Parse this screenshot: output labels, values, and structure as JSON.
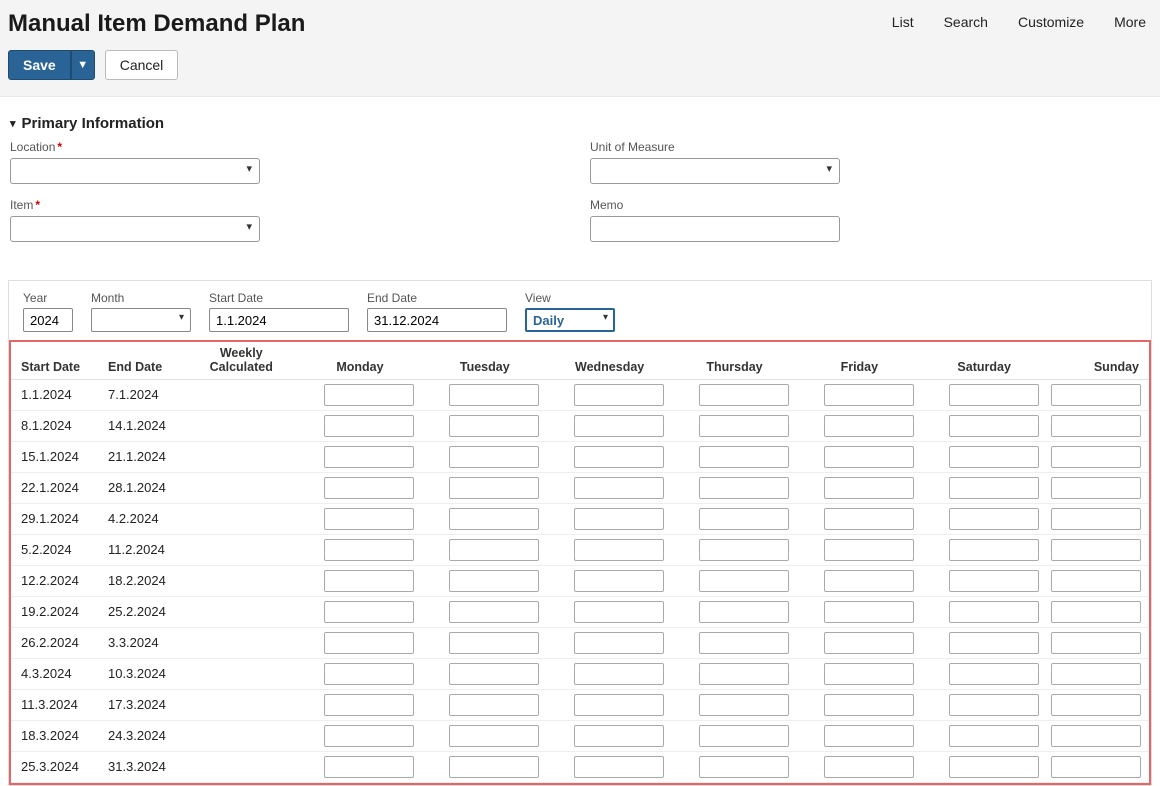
{
  "header": {
    "title": "Manual Item Demand Plan",
    "actions": [
      "List",
      "Search",
      "Customize",
      "More"
    ],
    "save_label": "Save",
    "cancel_label": "Cancel"
  },
  "primary": {
    "section_label": "Primary Information",
    "location_label": "Location",
    "location_value": "",
    "item_label": "Item",
    "item_value": "",
    "uom_label": "Unit of Measure",
    "uom_value": "",
    "memo_label": "Memo",
    "memo_value": ""
  },
  "filters": {
    "year_label": "Year",
    "year_value": "2024",
    "month_label": "Month",
    "month_value": "",
    "start_label": "Start Date",
    "start_value": "1.1.2024",
    "end_label": "End Date",
    "end_value": "31.12.2024",
    "view_label": "View",
    "view_value": "Daily"
  },
  "table": {
    "columns": {
      "start": "Start Date",
      "end": "End Date",
      "weekly_calc": "Weekly\nCalculated",
      "mon": "Monday",
      "tue": "Tuesday",
      "wed": "Wednesday",
      "thu": "Thursday",
      "fri": "Friday",
      "sat": "Saturday",
      "sun": "Sunday"
    },
    "rows": [
      {
        "start": "1.1.2024",
        "end": "7.1.2024",
        "wc": "",
        "days": [
          "",
          "",
          "",
          "",
          "",
          "",
          ""
        ]
      },
      {
        "start": "8.1.2024",
        "end": "14.1.2024",
        "wc": "",
        "days": [
          "",
          "",
          "",
          "",
          "",
          "",
          ""
        ]
      },
      {
        "start": "15.1.2024",
        "end": "21.1.2024",
        "wc": "",
        "days": [
          "",
          "",
          "",
          "",
          "",
          "",
          ""
        ]
      },
      {
        "start": "22.1.2024",
        "end": "28.1.2024",
        "wc": "",
        "days": [
          "",
          "",
          "",
          "",
          "",
          "",
          ""
        ]
      },
      {
        "start": "29.1.2024",
        "end": "4.2.2024",
        "wc": "",
        "days": [
          "",
          "",
          "",
          "",
          "",
          "",
          ""
        ]
      },
      {
        "start": "5.2.2024",
        "end": "11.2.2024",
        "wc": "",
        "days": [
          "",
          "",
          "",
          "",
          "",
          "",
          ""
        ]
      },
      {
        "start": "12.2.2024",
        "end": "18.2.2024",
        "wc": "",
        "days": [
          "",
          "",
          "",
          "",
          "",
          "",
          ""
        ]
      },
      {
        "start": "19.2.2024",
        "end": "25.2.2024",
        "wc": "",
        "days": [
          "",
          "",
          "",
          "",
          "",
          "",
          ""
        ]
      },
      {
        "start": "26.2.2024",
        "end": "3.3.2024",
        "wc": "",
        "days": [
          "",
          "",
          "",
          "",
          "",
          "",
          ""
        ]
      },
      {
        "start": "4.3.2024",
        "end": "10.3.2024",
        "wc": "",
        "days": [
          "",
          "",
          "",
          "",
          "",
          "",
          ""
        ]
      },
      {
        "start": "11.3.2024",
        "end": "17.3.2024",
        "wc": "",
        "days": [
          "",
          "",
          "",
          "",
          "",
          "",
          ""
        ]
      },
      {
        "start": "18.3.2024",
        "end": "24.3.2024",
        "wc": "",
        "days": [
          "",
          "",
          "",
          "",
          "",
          "",
          ""
        ]
      },
      {
        "start": "25.3.2024",
        "end": "31.3.2024",
        "wc": "",
        "days": [
          "",
          "",
          "",
          "",
          "",
          "",
          ""
        ]
      }
    ]
  }
}
